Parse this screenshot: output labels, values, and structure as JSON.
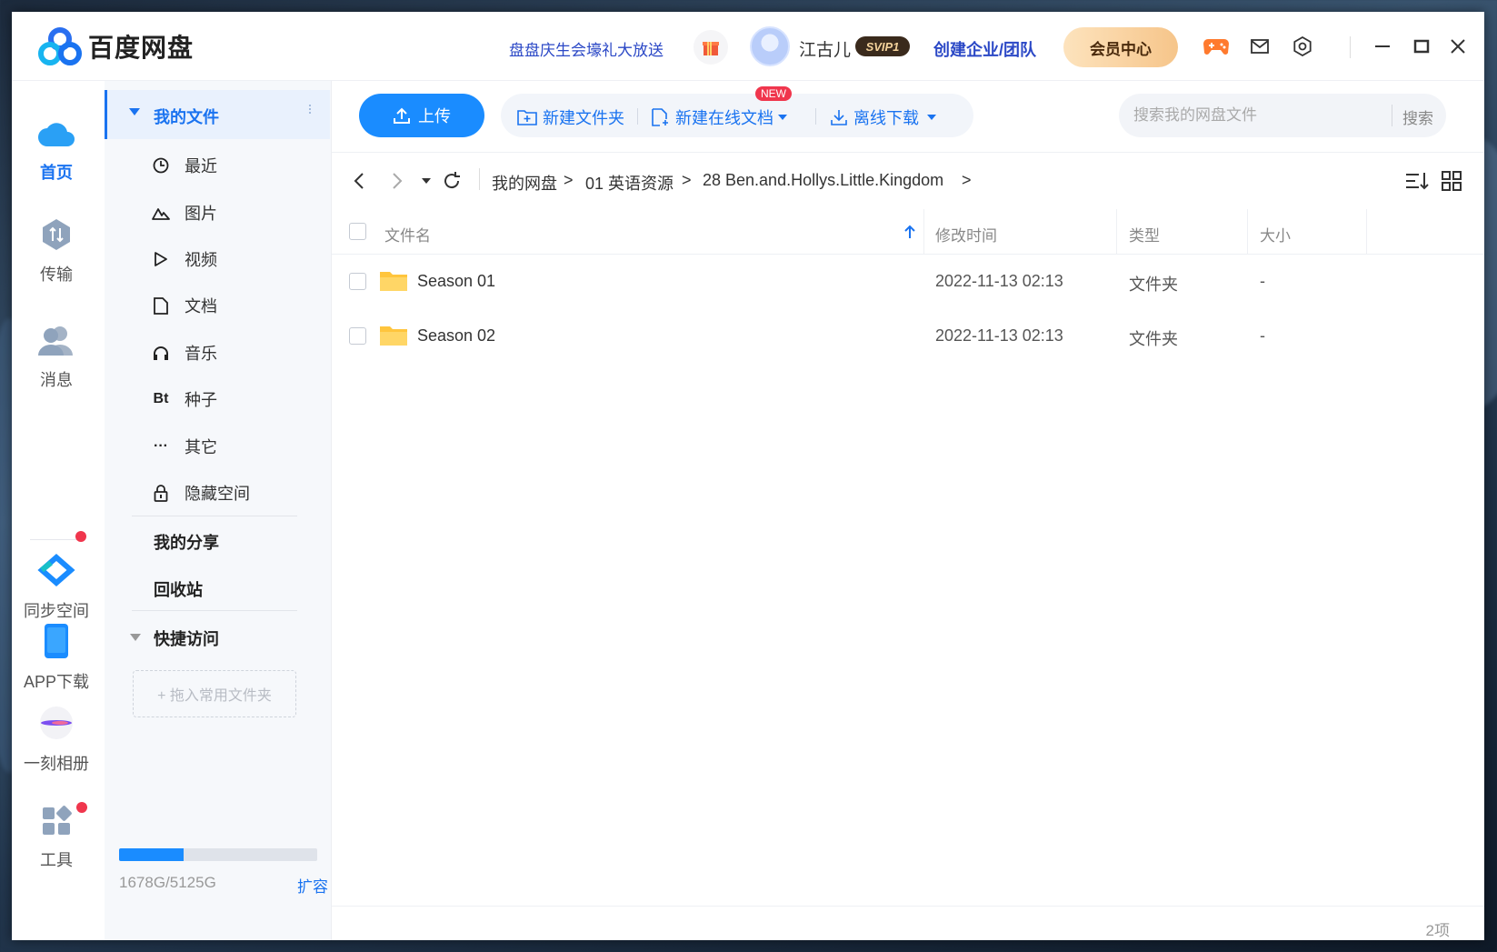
{
  "app": {
    "name": "百度网盘",
    "promo": "盘盘庆生会壕礼大放送",
    "username": "江古儿",
    "vip_badge": "SVIP1",
    "enterprise": "创建企业/团队",
    "member_center": "会员中心"
  },
  "rail": {
    "items": [
      {
        "label": "首页",
        "icon": "cloud-icon",
        "active": true
      },
      {
        "label": "传输",
        "icon": "transfer-icon"
      },
      {
        "label": "消息",
        "icon": "users-icon"
      },
      {
        "label": "同步空间",
        "icon": "sync-icon",
        "badge": true
      },
      {
        "label": "APP下载",
        "icon": "phone-icon"
      },
      {
        "label": "一刻相册",
        "icon": "album-icon"
      },
      {
        "label": "工具",
        "icon": "tools-icon",
        "badge": true
      }
    ]
  },
  "sidebar": {
    "my_files": "我的文件",
    "items": [
      {
        "label": "最近",
        "icon": "clock-icon"
      },
      {
        "label": "图片",
        "icon": "image-icon"
      },
      {
        "label": "视频",
        "icon": "play-icon"
      },
      {
        "label": "文档",
        "icon": "document-icon"
      },
      {
        "label": "音乐",
        "icon": "headphones-icon"
      },
      {
        "label": "种子",
        "icon": "bt-icon",
        "glyph": "Bt"
      },
      {
        "label": "其它",
        "icon": "more-icon",
        "glyph": "···"
      },
      {
        "label": "隐藏空间",
        "icon": "lock-icon"
      }
    ],
    "my_share": "我的分享",
    "recycle": "回收站",
    "quick_access": "快捷访问",
    "dropzone": "+ 拖入常用文件夹",
    "quota_text": "1678G/5125G",
    "quota_used_fraction": 0.327,
    "expand": "扩容"
  },
  "toolbar": {
    "upload": "上传",
    "new_folder": "新建文件夹",
    "new_online_doc": "新建在线文档",
    "new_badge": "NEW",
    "offline_download": "离线下载",
    "search_placeholder": "搜索我的网盘文件",
    "search_button": "搜索"
  },
  "breadcrumb": [
    "我的网盘",
    "01 英语资源",
    "28 Ben.and.Hollys.Little.Kingdom"
  ],
  "table": {
    "headers": {
      "name": "文件名",
      "modified": "修改时间",
      "type": "类型",
      "size": "大小"
    },
    "rows": [
      {
        "name": "Season 01",
        "modified": "2022-11-13 02:13",
        "type": "文件夹",
        "size": "-"
      },
      {
        "name": "Season 02",
        "modified": "2022-11-13 02:13",
        "type": "文件夹",
        "size": "-"
      }
    ]
  },
  "footer": {
    "count": "2项"
  },
  "colors": {
    "accent": "#1a73f0",
    "upload": "#1a8cff",
    "folder": "#ffc53d",
    "badge": "#f0364d"
  }
}
